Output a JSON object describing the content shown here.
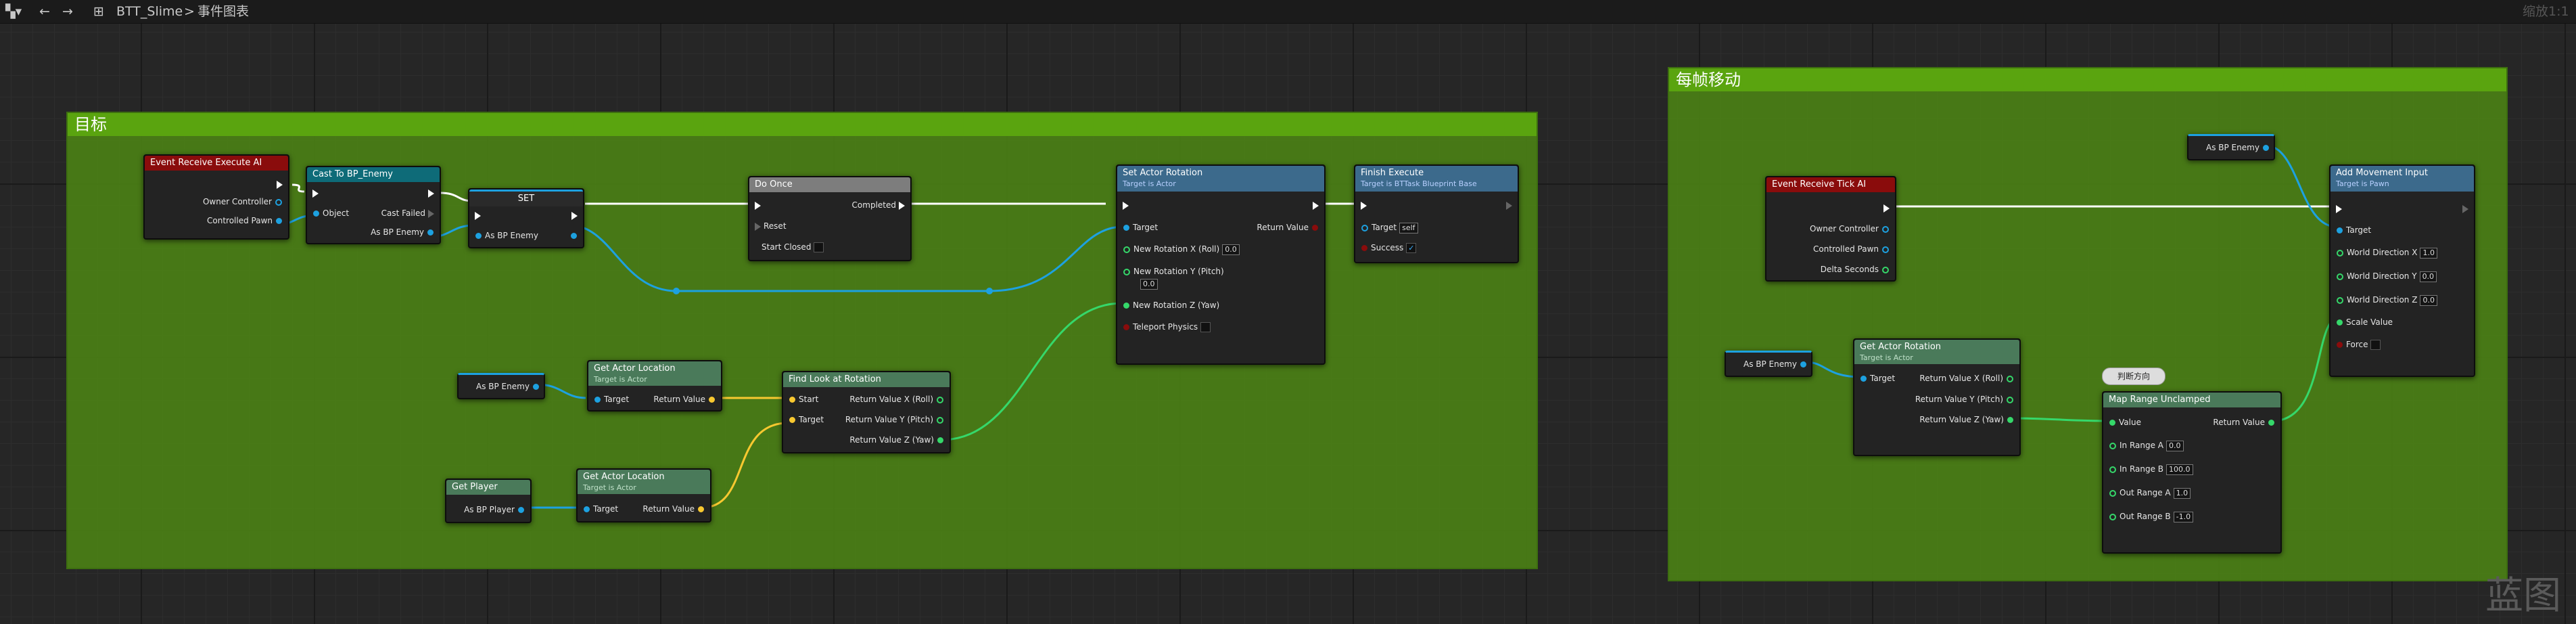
{
  "toolbar": {
    "breadcrumb_root": "BTT_Slime",
    "breadcrumb_sep": ">",
    "breadcrumb_page": "事件图表",
    "zoom": "缩放1:1"
  },
  "comments": {
    "left_title": "目标",
    "right_title": "每帧移动"
  },
  "nodes": {
    "receive_execute": {
      "title": "Event Receive Execute AI",
      "pins": [
        "Owner Controller",
        "Controlled Pawn"
      ]
    },
    "cast": {
      "title": "Cast To BP_Enemy",
      "pins": [
        "Object",
        "Cast Failed",
        "As BP Enemy"
      ]
    },
    "set": {
      "title": "SET",
      "pins": [
        "As BP Enemy"
      ]
    },
    "do_once": {
      "title": "Do Once",
      "pins": [
        "Completed",
        "Reset",
        "Start Closed"
      ]
    },
    "set_rotation": {
      "title": "Set Actor Rotation",
      "subtitle": "Target is Actor",
      "pins": [
        "Target",
        "Return Value",
        "New Rotation X (Roll)",
        "New Rotation Y (Pitch)",
        "New Rotation Z (Yaw)",
        "Teleport Physics"
      ],
      "values": [
        "0.0",
        "0.0"
      ]
    },
    "finish": {
      "title": "Finish Execute",
      "subtitle": "Target is BTTask Blueprint Base",
      "pins": [
        "Target",
        "Success"
      ],
      "target_value": "self"
    },
    "as_bp_enemy_var": {
      "title": "As BP Enemy"
    },
    "get_loc_1": {
      "title": "Get Actor Location",
      "subtitle": "Target is Actor",
      "pins": [
        "Target",
        "Return Value"
      ]
    },
    "find_look": {
      "title": "Find Look at Rotation",
      "pins": [
        "Start",
        "Target",
        "Return Value X (Roll)",
        "Return Value Y (Pitch)",
        "Return Value Z (Yaw)"
      ]
    },
    "get_player": {
      "title": "Get Player",
      "pins": [
        "As BP Player"
      ]
    },
    "get_loc_2": {
      "title": "Get Actor Location",
      "subtitle": "Target is Actor",
      "pins": [
        "Target",
        "Return Value"
      ]
    },
    "receive_tick": {
      "title": "Event Receive Tick AI",
      "pins": [
        "Owner Controller",
        "Controlled Pawn",
        "Delta Seconds"
      ]
    },
    "as_bp_enemy_top": {
      "title": "As BP Enemy"
    },
    "add_movement": {
      "title": "Add Movement Input",
      "subtitle": "Target is Pawn",
      "pins": [
        "Target",
        "World Direction X",
        "World Direction Y",
        "World Direction Z",
        "Scale Value",
        "Force"
      ],
      "values": [
        "1.0",
        "0.0",
        "0.0"
      ]
    },
    "as_bp_enemy_mid": {
      "title": "As BP Enemy"
    },
    "get_rotation": {
      "title": "Get Actor Rotation",
      "subtitle": "Target is Actor",
      "pins": [
        "Target",
        "Return Value X (Roll)",
        "Return Value Y (Pitch)",
        "Return Value Z (Yaw)"
      ]
    },
    "judge_label": {
      "title": "判断方向"
    },
    "map_range": {
      "title": "Map Range Unclamped",
      "pins": [
        "Value",
        "Return Value",
        "In Range A",
        "In Range B",
        "Out Range A",
        "Out Range B"
      ],
      "values": [
        "0.0",
        "100.0",
        "1.0",
        "-1.0"
      ]
    }
  },
  "watermark": "蓝图",
  "colors": {
    "exec": "#ffffff",
    "object": "#1da1e0",
    "vector": "#f8c830",
    "float": "#35d86a",
    "comment": "#5aa40f",
    "event_head": "#8a0c0c",
    "func_head": "#3c6a8c",
    "cast_head": "#0e6b78"
  }
}
